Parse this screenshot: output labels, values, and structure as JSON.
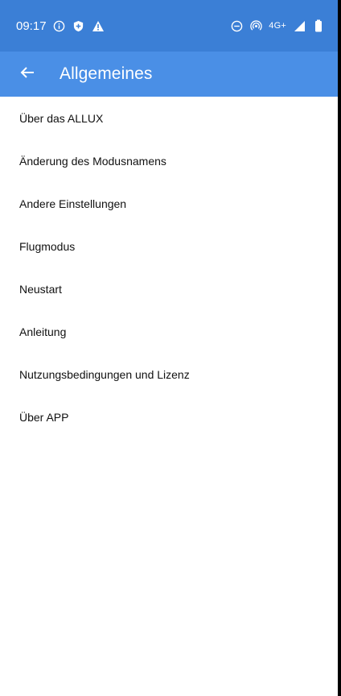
{
  "status_bar": {
    "time": "09:17",
    "network_label": "4G+",
    "icons": [
      "info-icon",
      "shield-icon",
      "warning-icon",
      "dnd-icon",
      "hotspot-icon",
      "signal-icon",
      "battery-icon"
    ]
  },
  "app_bar": {
    "title": "Allgemeines",
    "back_icon": "arrow-left-icon"
  },
  "menu": {
    "items": [
      {
        "label": "Über das ALLUX"
      },
      {
        "label": "Änderung des Modusnamens"
      },
      {
        "label": "Andere Einstellungen"
      },
      {
        "label": "Flugmodus"
      },
      {
        "label": "Neustart"
      },
      {
        "label": "Anleitung"
      },
      {
        "label": "Nutzungsbedingungen und Lizenz"
      },
      {
        "label": "Über APP"
      }
    ]
  },
  "colors": {
    "status_bar": "#3b7fd6",
    "app_bar": "#4a8fe6",
    "text": "#111111",
    "background": "#ffffff"
  }
}
